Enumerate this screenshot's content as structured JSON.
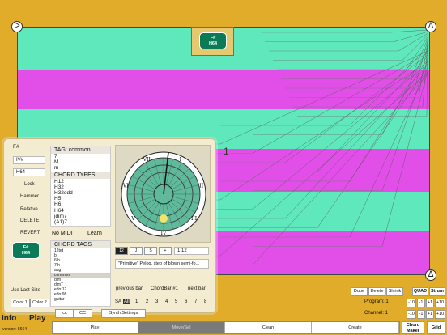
{
  "colors": {
    "background": "#e1ac2a",
    "green": "#5ee8bb",
    "magenta": "#e14fe8",
    "chip": "#0b7a57"
  },
  "stripes": [
    {
      "color": "green",
      "from": 0.0,
      "to": 0.17
    },
    {
      "color": "magenta",
      "from": 0.17,
      "to": 0.33
    },
    {
      "color": "green",
      "from": 0.33,
      "to": 0.49
    },
    {
      "color": "magenta",
      "from": 0.49,
      "to": 0.66
    },
    {
      "color": "green",
      "from": 0.66,
      "to": 0.82
    },
    {
      "color": "magenta",
      "from": 0.82,
      "to": 1.0
    }
  ],
  "canvas": {
    "chord_chip": {
      "name": "F#",
      "type": "H64"
    },
    "bar_marker": "1"
  },
  "panel": {
    "root_label": "F#",
    "roman_field": "IV#",
    "type_field": "H64",
    "left_buttons": [
      "Lock",
      "Hammer",
      "Relative",
      "DELETE",
      "REVERT"
    ],
    "chip": {
      "name": "F#",
      "type": "H64"
    },
    "tag_list": {
      "header": "TAG: common",
      "items": [
        "7",
        "M",
        "m"
      ],
      "types_header": "CHORD TYPES",
      "types": [
        "H12",
        "H32",
        "H32odd",
        "H5",
        "H6",
        "H64",
        "jdim7",
        "(A1)7"
      ]
    },
    "no_midi": "No MIDI",
    "learn": "Learn",
    "chord_tags": {
      "header": "CHORD TAGS",
      "items": [
        "12tet",
        "bi",
        "6th",
        "7th",
        "aug",
        "common",
        "dim",
        "dim7",
        "edo:12",
        "edo:98",
        "guitar"
      ],
      "selected": "common"
    },
    "wheel_labels": [
      "I",
      "II",
      "III",
      "IV",
      "V",
      "VI",
      "VII"
    ],
    "segments": [
      "12",
      "J",
      "S",
      "+"
    ],
    "ratio": "1:12",
    "description": "\"Primitive\" Pelog, step of blown semi-fo...",
    "nav": {
      "prev": "previous bar",
      "current": "ChordBar #1",
      "next": "next bar"
    },
    "numbers": [
      "SA",
      "All",
      "1",
      "2",
      "3",
      "4",
      "5",
      "6",
      "7",
      "8"
    ],
    "selected_number": "All",
    "use_last_size": "Use Last Size",
    "color1": "Color 1",
    "color2": "Color 2"
  },
  "bottom": {
    "info": "Info",
    "play": "Play",
    "version": "version: 5664",
    "hidden_btns": [
      "cc",
      "CC",
      "Synth Settings"
    ],
    "dupe": "Dupe",
    "delete": "Delete",
    "shrink": "Shrink",
    "quad": "QUAD",
    "strum": "Strum",
    "program_label": "Program: 1",
    "channel_label": "Channel: 1",
    "steppers": [
      "-10",
      "-1",
      "+1",
      "+10"
    ],
    "tabs": [
      "Play",
      "Move/Sel",
      "Clean",
      "Create"
    ],
    "chord_maker": "Chord Maker",
    "grid": "Grid"
  }
}
